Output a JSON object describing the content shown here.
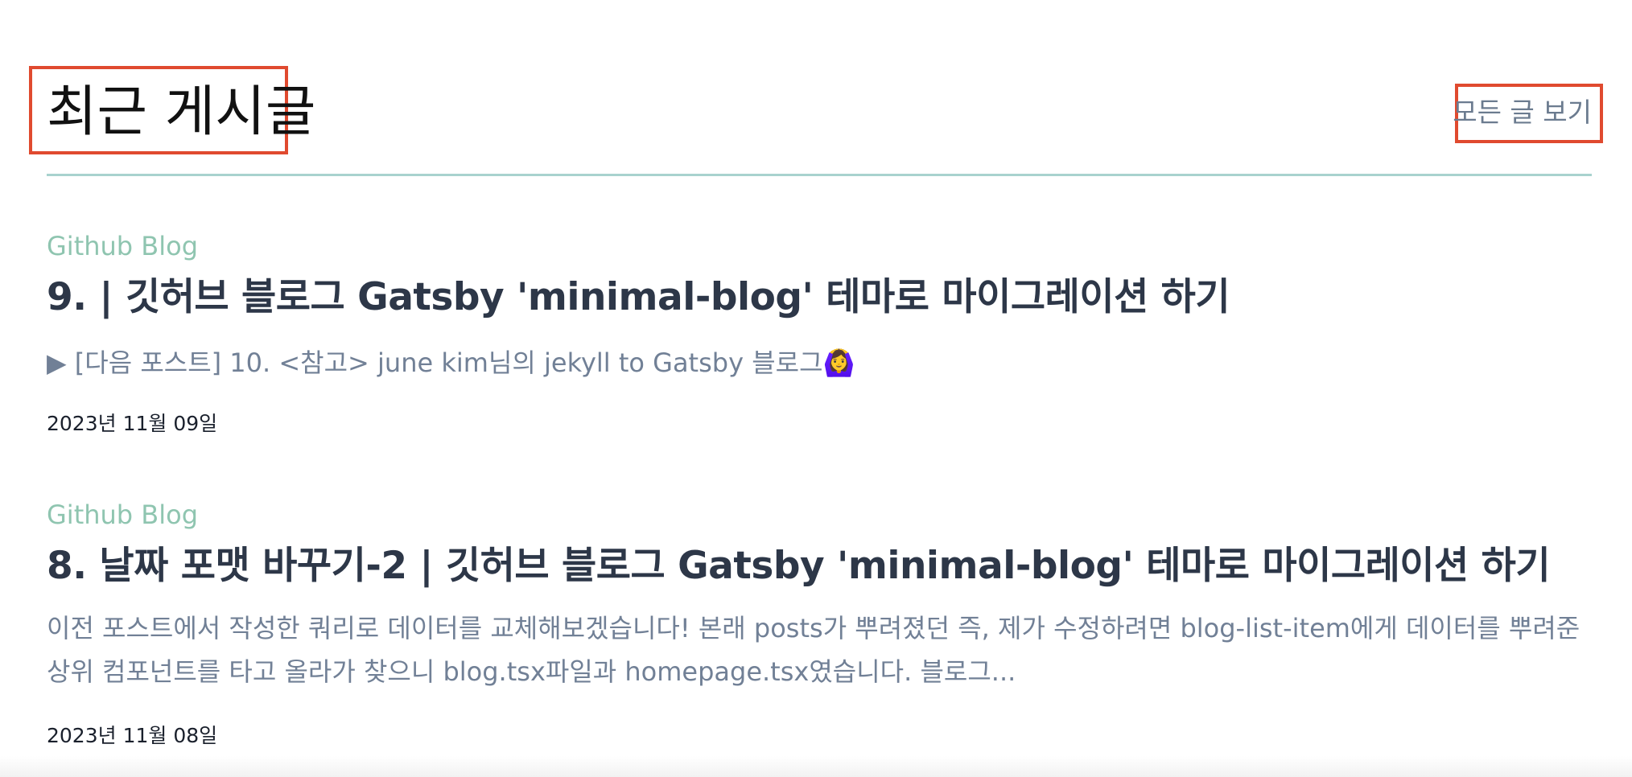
{
  "section": {
    "title": "최근 게시글",
    "view_all_label": "모든 글 보기"
  },
  "posts": [
    {
      "category": "Github Blog",
      "title": "9. | 깃허브 블로그 Gatsby 'minimal-blog' 테마로 마이그레이션 하기",
      "excerpt": "▶ [다음 포스트] 10. <참고> june kim님의 jekyll to Gatsby 블로그🙆‍♀️",
      "date": "2023년 11월 09일"
    },
    {
      "category": "Github Blog",
      "title": "8. 날짜 포맷 바꾸기-2 | 깃허브 블로그 Gatsby 'minimal-blog' 테마로 마이그레이션 하기",
      "excerpt": "이전 포스트에서 작성한 쿼리로 데이터를 교체해보겠습니다! 본래 posts가 뿌려졌던 즉, 제가 수정하려면 blog-list-item에게 데이터를 뿌려준 상위 컴포넌트를 타고 올라가 찾으니 blog.tsx파일과 homepage.tsx였습니다. 블로그...",
      "date": "2023년 11월 08일"
    }
  ],
  "colors": {
    "accent_highlight": "#e04a2f",
    "divider": "#a8d2ce",
    "category": "#8fc5b0",
    "title": "#2d3748",
    "excerpt": "#718096"
  }
}
